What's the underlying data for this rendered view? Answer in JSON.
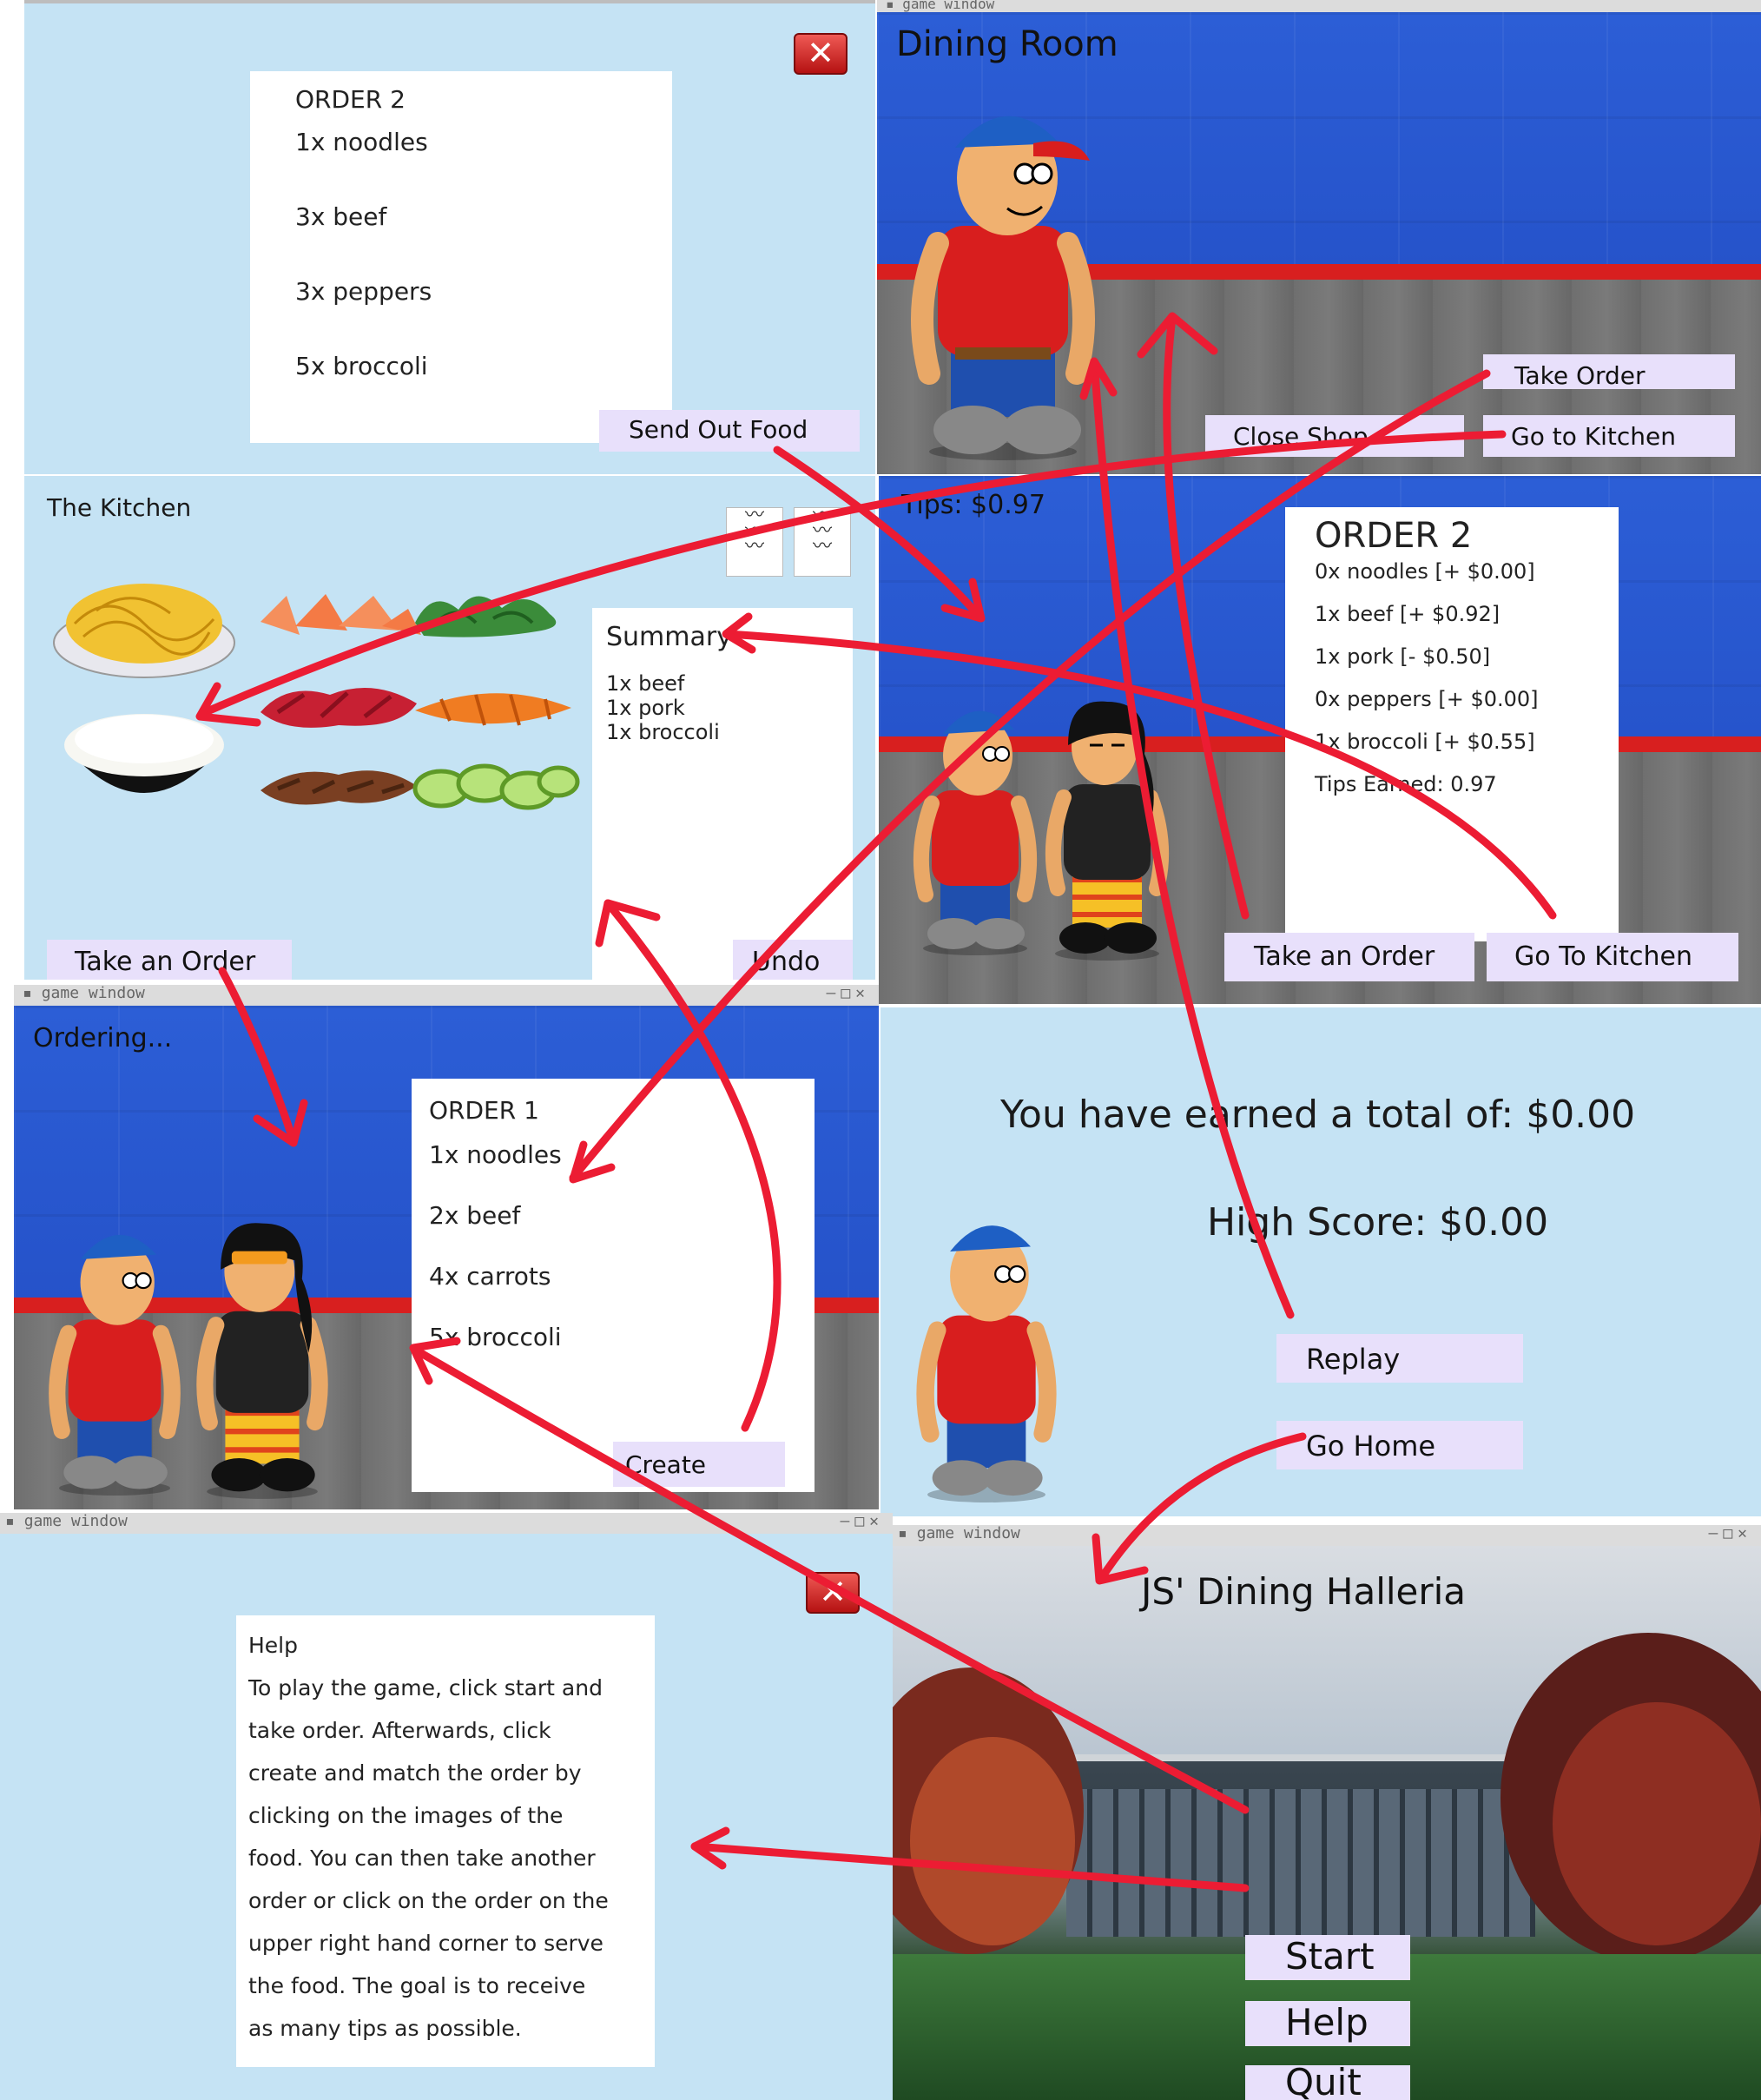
{
  "window_title": "game window",
  "order_popup": {
    "title": "ORDER 2",
    "items": [
      "1x noodles",
      "3x beef",
      "3x peppers",
      "5x broccoli"
    ],
    "send_button": "Send Out Food",
    "close_icon": "close-icon"
  },
  "dining_room": {
    "title": "Dining Room",
    "take_order_button": "Take Order",
    "close_shop_button": "Close Shop",
    "kitchen_button": "Go to Kitchen"
  },
  "kitchen": {
    "title": "The Kitchen",
    "summary_title": "Summary",
    "summary_items": [
      "1x beef",
      "1x pork",
      "1x broccoli"
    ],
    "take_order_button": "Take an Order",
    "undo_button": "Undo",
    "ticket_icons": [
      "order-ticket-icon",
      "order-ticket-icon"
    ],
    "foods": [
      "noodles",
      "salmon",
      "broccoli",
      "rice",
      "beef",
      "carrots",
      "pork",
      "peppers"
    ]
  },
  "result": {
    "tips": "Tips: $0.97",
    "title": "ORDER 2",
    "lines": [
      "0x noodles [+ $0.00]",
      "1x beef [+ $0.92]",
      "1x pork [- $0.50]",
      "0x peppers [+ $0.00]",
      "1x broccoli [+ $0.55]",
      "Tips Earned: 0.97"
    ],
    "take_order_button": "Take an Order",
    "kitchen_button": "Go To Kitchen"
  },
  "ordering": {
    "status": "Ordering...",
    "title": "ORDER 1",
    "items": [
      "1x noodles",
      "2x beef",
      "4x carrots",
      "5x broccoli"
    ],
    "create_button": "Create"
  },
  "end_screen": {
    "total": "You have earned a total of: $0.00",
    "high_score": "High Score: $0.00",
    "replay_button": "Replay",
    "home_button": "Go Home"
  },
  "help": {
    "title": "Help",
    "lines": [
      "To play the game, click start and",
      "take order. Afterwards, click",
      "create and match the order by",
      "clicking on the images of the",
      "food. You can then take another",
      "order or click on the order on the",
      "upper right hand corner to serve",
      "the food. The goal is to receive",
      "as many tips as possible."
    ]
  },
  "home": {
    "title": "JS' Dining Halleria",
    "start_button": "Start",
    "help_button": "Help",
    "quit_button": "Quit"
  },
  "colors": {
    "panel_bg": "#c5e3f4",
    "button_bg": "#e8e0fb",
    "arrow": "#ec1c33",
    "wall": "#2552c9",
    "rail": "#d81f1f"
  }
}
